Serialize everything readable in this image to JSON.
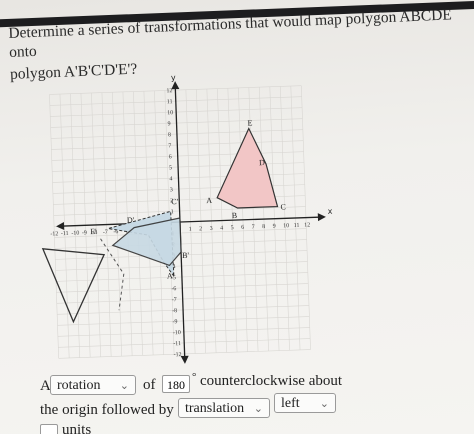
{
  "question": {
    "line1": "Determine a series of transformations that would map polygon ABCDE onto",
    "line2": "polygon A'B'C'D'E'?"
  },
  "graph": {
    "axis_x_label": "x",
    "axis_y_label": "y",
    "x_ticks_positive": [
      "1",
      "2",
      "3",
      "4",
      "5",
      "6",
      "7",
      "8",
      "9",
      "10",
      "11",
      "12"
    ],
    "x_ticks_negative": [
      "-12",
      "-11",
      "-10",
      "-9",
      "-8",
      "-7",
      "-6",
      "-5",
      "-4",
      "-3",
      "-2"
    ],
    "y_ticks_positive": [
      "1",
      "2",
      "3",
      "4",
      "5",
      "6",
      "7",
      "8",
      "9",
      "10",
      "11",
      "12"
    ],
    "y_ticks_negative": [
      "-1",
      "-2",
      "-3",
      "-4",
      "-5",
      "-6",
      "-7",
      "-8",
      "-9",
      "-10",
      "-11",
      "-12"
    ],
    "original_labels": {
      "A": "A",
      "B": "B",
      "C": "C",
      "D": "D",
      "E": "E"
    },
    "image_labels": {
      "A": "A'",
      "B": "B'",
      "C": "C'",
      "D": "D'",
      "E": "E'"
    },
    "fill_color": "#f2c6c6",
    "image_fill_color": "#c7d9e4"
  },
  "answer": {
    "prefix": "A",
    "transform1": "rotation",
    "of_label": "of",
    "angle": "180",
    "degree_symbol": "°",
    "direction_text": "counterclockwise about",
    "line2_prefix": "the origin followed by a",
    "transform2": "translation",
    "direction2": "left",
    "units_label": "units"
  }
}
